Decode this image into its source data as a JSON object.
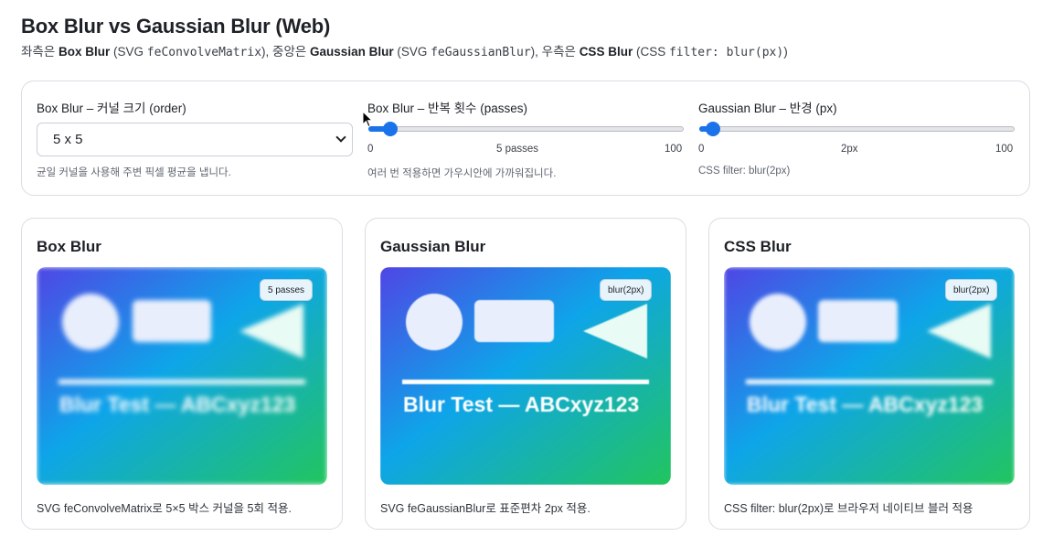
{
  "page": {
    "title": "Box Blur vs Gaussian Blur (Web)",
    "subtitle": {
      "s1": "좌측은 ",
      "b1": "Box Blur",
      "s2": " (SVG ",
      "m1": "feConvolveMatrix",
      "s3": "), 중앙은 ",
      "b2": "Gaussian Blur",
      "s4": " (SVG ",
      "m2": "feGaussianBlur",
      "s5": "), 우측은 ",
      "b3": "CSS Blur",
      "s6": " (CSS ",
      "m3": "filter: blur(px)",
      "s7": ")"
    }
  },
  "controls": {
    "order": {
      "label": "Box Blur – 커널 크기 (order)",
      "selected": "5 x 5",
      "help": "균일 커널을 사용해 주변 픽셀 평균을 냅니다."
    },
    "passes": {
      "label": "Box Blur – 반복 횟수 (passes)",
      "min": "0",
      "max": "100",
      "value_label": "5 passes",
      "value": 5,
      "help": "여러 번 적용하면 가우시안에 가까워집니다."
    },
    "radius": {
      "label": "Gaussian Blur – 반경 (px)",
      "min": "0",
      "max": "100",
      "value_label": "2px",
      "value": 2,
      "help": "CSS filter: blur(2px)"
    }
  },
  "cards": [
    {
      "title": "Box Blur",
      "badge": "5 passes",
      "caption": "SVG feConvolveMatrix로 5×5 박스 커널을 5회 적용.",
      "image_text": "Blur Test — ABCxyz123"
    },
    {
      "title": "Gaussian Blur",
      "badge": "blur(2px)",
      "caption": "SVG feGaussianBlur로 표준편차 2px 적용.",
      "image_text": "Blur Test — ABCxyz123"
    },
    {
      "title": "CSS Blur",
      "badge": "blur(2px)",
      "caption": "CSS filter: blur(2px)로 브라우저 네이티브 블러 적용",
      "image_text": "Blur Test — ABCxyz123"
    }
  ],
  "colors": {
    "accent": "#1a73e8",
    "gradient_start": "#4f46e5",
    "gradient_mid": "#0ea5e9",
    "gradient_end": "#22c55e"
  },
  "icons": {
    "cursor": "mouse-pointer-icon",
    "select": "chevron-down-icon"
  }
}
